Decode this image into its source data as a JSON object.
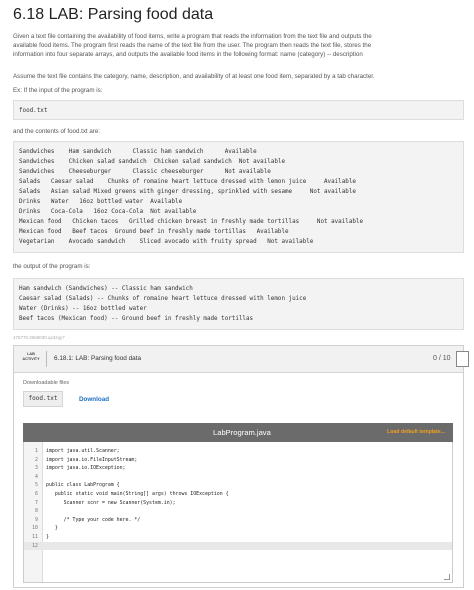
{
  "title": "6.18 LAB: Parsing food data",
  "intro_lines": [
    "Given a text file containing the availability of food items, write a program that reads the information from the text file and outputs the",
    "available food items. The program first reads the name of the text file from the user. The program then reads the text file, stores the",
    "information into four separate arrays, and outputs the available food items in the following format: name (category) -- description"
  ],
  "assume_text": "Assume the text file contains the category, name, description, and availability of at least one food item, separated by a tab character.",
  "example_intro": "Ex: If the input of the program is:",
  "input_example": "food.txt",
  "contents_label": "and the contents of food.txt are:",
  "file_contents": [
    "Sandwiches    Ham sandwich      Classic ham sandwich      Available",
    "Sandwiches    Chicken salad sandwich  Chicken salad sandwich  Not available",
    "Sandwiches    Cheeseburger      Classic cheeseburger      Not available",
    "Salads   Caesar salad    Chunks of romaine heart lettuce dressed with lemon juice     Available",
    "Salads   Asian salad Mixed greens with ginger dressing, sprinkled with sesame     Not available",
    "Drinks   Water   16oz bottled water  Available",
    "Drinks   Coca-Cola   16oz Coca-Cola  Not available",
    "Mexican food   Chicken tacos   Grilled chicken breast in freshly made tortillas     Not available",
    "Mexican food   Beef tacos  Ground beef in freshly made tortillas   Available",
    "Vegetarian    Avocado sandwich    Sliced avocado with fruity spread   Not available"
  ],
  "output_label": "the output of the program is:",
  "output_lines": [
    "Ham sandwich (Sandwiches) -- Classic ham sandwich",
    "Caesar salad (Salads) -- Chunks of romaine heart lettuce dressed with lemon juice",
    "Water (Drinks) -- 16oz bottled water",
    "Beef tacos (Mexican food) -- Ground beef in freshly made tortillas"
  ],
  "reference_id": "475770.3669030.qx3zqy7",
  "lab": {
    "badge_line1": "LAB",
    "badge_line2": "ACTIVITY",
    "title": "6.18.1: LAB: Parsing food data",
    "score": "0 / 10",
    "downloadable_label": "Downloadable files",
    "file_name": "food.txt",
    "download_label": "Download",
    "editor_filename": "LabProgram.java",
    "load_template": "Load default template...",
    "code": [
      {
        "n": "1",
        "t": "import java.util.Scanner;"
      },
      {
        "n": "2",
        "t": "import java.io.FileInputStream;"
      },
      {
        "n": "3",
        "t": "import java.io.IOException;"
      },
      {
        "n": "4",
        "t": ""
      },
      {
        "n": "5",
        "t": "public class LabProgram {"
      },
      {
        "n": "6",
        "t": "   public static void main(String[] args) throws IOException {"
      },
      {
        "n": "7",
        "t": "      Scanner scnr = new Scanner(System.in);"
      },
      {
        "n": "8",
        "t": ""
      },
      {
        "n": "9",
        "t": "      /* Type your code here. */"
      },
      {
        "n": "10",
        "t": "   }"
      },
      {
        "n": "11",
        "t": "}"
      },
      {
        "n": "12",
        "t": ""
      }
    ]
  }
}
